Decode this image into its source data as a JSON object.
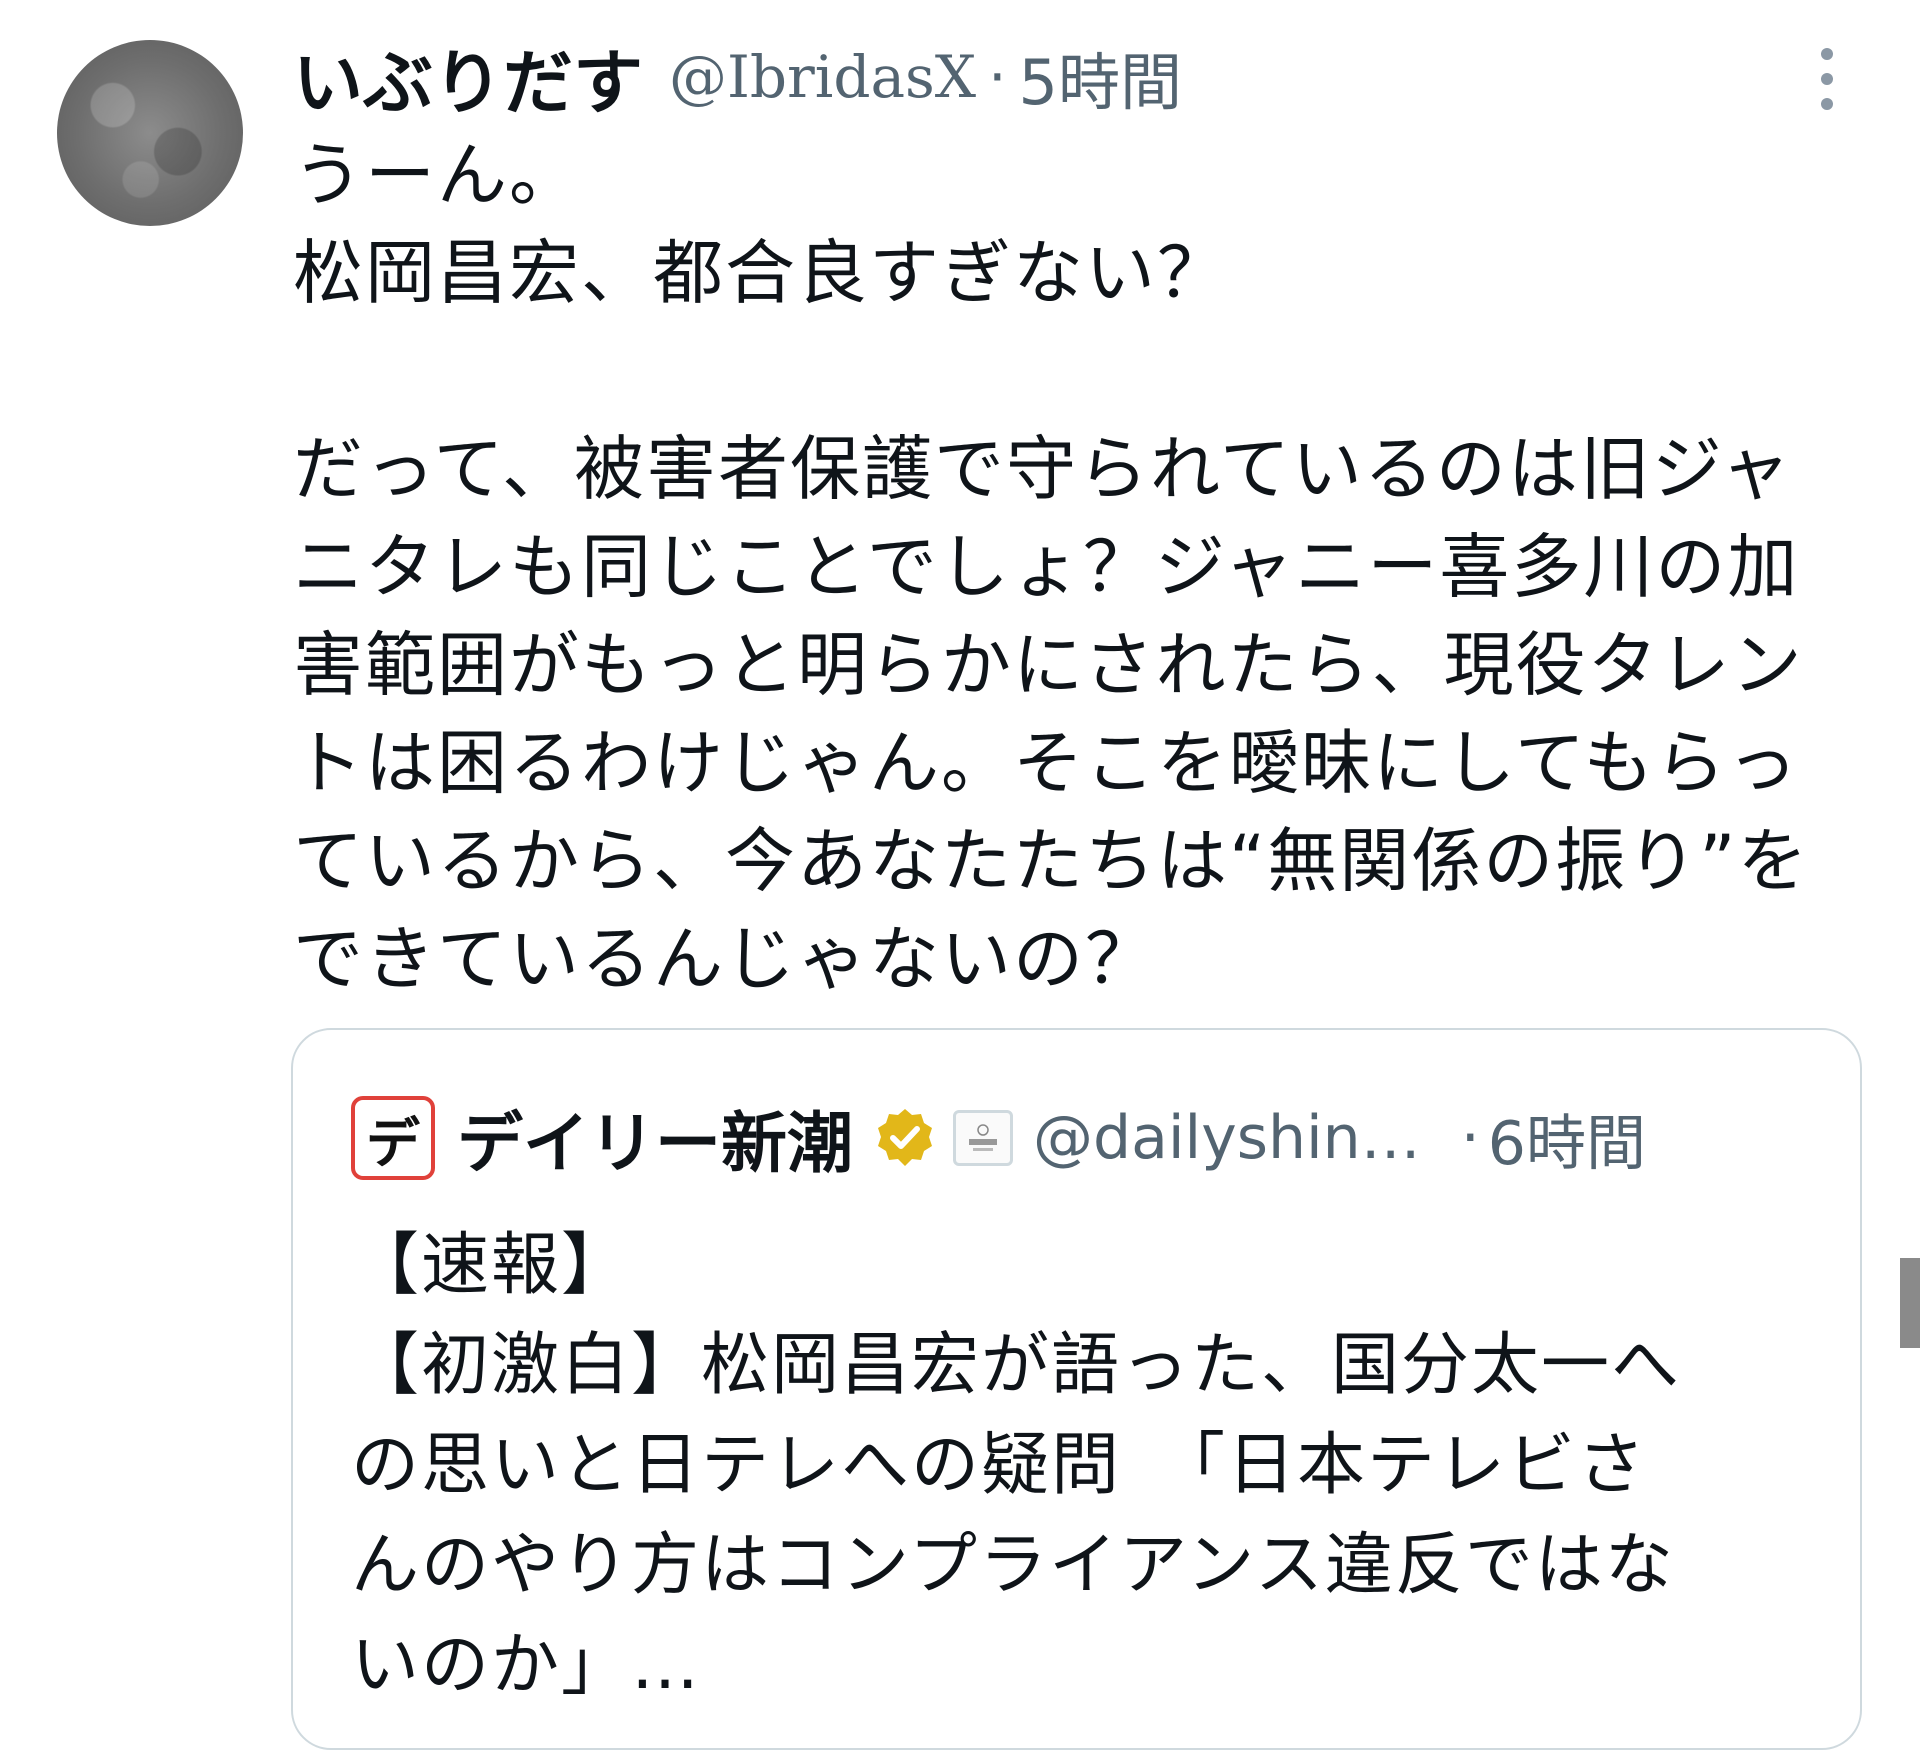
{
  "tweet": {
    "display_name": "いぶりだす",
    "handle": "@IbridasX",
    "separator": "·",
    "time": "5時間",
    "avatar_icon": "moon-avatar",
    "more_icon": "more-vertical-icon",
    "body_lines": [
      "うーん。",
      "松岡昌宏、都合良すぎない？",
      "",
      "だって、被害者保護で守られているのは旧ジャ",
      "ニタレも同じことでしょ？ジャニー喜多川の加",
      "害範囲がもっと明らかにされたら、現役タレン",
      "トは困るわけじゃん。そこを曖昧にしてもらっ",
      "ているから、今あなたたちは“無関係の振り”を",
      "できているんじゃないの？"
    ]
  },
  "quoted": {
    "logo_text": "デ",
    "display_name": "デイリー新潮",
    "verified_icon": "verified-badge-gold-icon",
    "affiliate_icon": "shinchosha-affiliate-icon",
    "handle": "@dailyshin…",
    "separator": "·",
    "time": "6時間",
    "body_lines": [
      "【速報】",
      "【初激白】松岡昌宏が語った、国分太一へ",
      "の思いと日テレへの疑問　「日本テレビさ",
      "んのやり方はコンプライアンス違反ではな",
      "いのか」…"
    ]
  },
  "colors": {
    "text": "#0f1419",
    "secondary": "#536471",
    "border": "#cfd9de",
    "verified_gold": "#e2b719",
    "logo_red": "#e0413a"
  }
}
